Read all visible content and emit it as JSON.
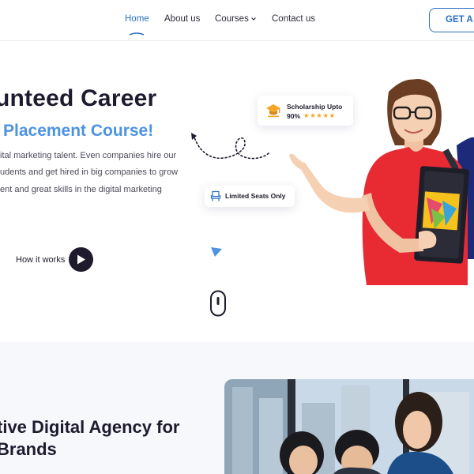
{
  "nav": {
    "items": [
      {
        "label": "Home",
        "active": true
      },
      {
        "label": "About us",
        "active": false
      },
      {
        "label": "Courses",
        "active": false,
        "has_dropdown": true
      },
      {
        "label": "Contact us",
        "active": false
      }
    ],
    "cta_label": "GET A F"
  },
  "hero": {
    "title": "unteed Career",
    "subtitle": "Placement Course!",
    "description": [
      "ital marketing talent. Even companies hire our",
      "udents and get hired in big companies to grow",
      "ent and great skills in the digital marketing"
    ],
    "how_it_works_label": "How it works",
    "scholarship": {
      "title": "Scholarship Upto",
      "percent": "90%",
      "stars": "★★★★★",
      "rating": 5
    },
    "limited_seats_label": "Limited Seats Only"
  },
  "section2": {
    "title_line1": "tive Digital Agency for",
    "title_line2": "Brands"
  },
  "colors": {
    "accent": "#2a6fc0",
    "subtitle_blue": "#4d93e0",
    "dark": "#1e1b2e",
    "star": "#f5a623",
    "shirt_red": "#e82a33"
  },
  "icons": [
    "chevron-down-icon",
    "graduation-cap-icon",
    "chair-icon",
    "play-icon",
    "mouse-scroll-icon",
    "arrow-squiggle-icon",
    "triangle-icon"
  ]
}
